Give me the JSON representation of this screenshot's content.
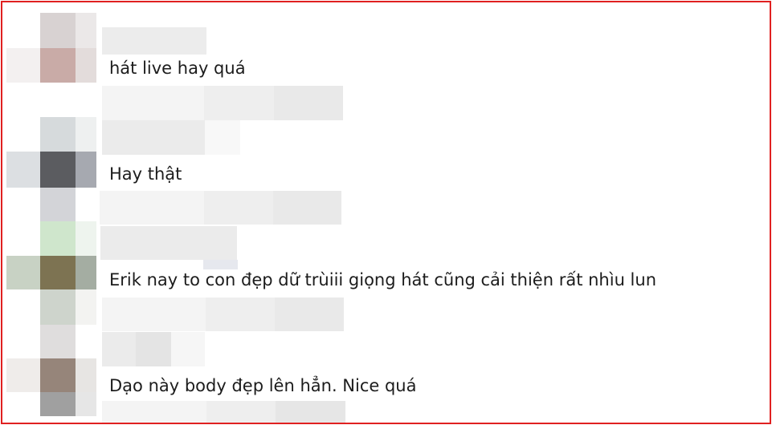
{
  "comments": [
    {
      "text": "hát live hay quá"
    },
    {
      "text": "Hay thật"
    },
    {
      "text": "Erik nay to con đẹp dữ trùiii giọng hát cũng cải thiện rất nhìu lun"
    },
    {
      "text": "Dạo này body đẹp lên hẳn. Nice quá"
    }
  ],
  "colors": {
    "border": "#e02020",
    "text": "#1c1c1c",
    "background": "#ffffff"
  }
}
